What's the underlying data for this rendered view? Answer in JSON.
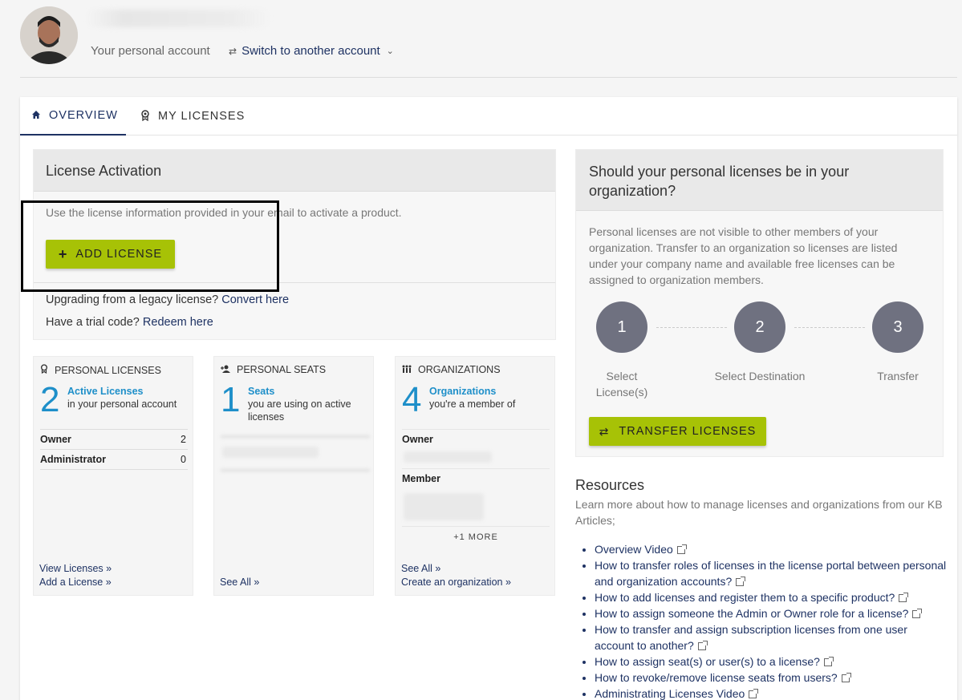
{
  "account": {
    "label": "Your personal account",
    "switch_label": "Switch to another account"
  },
  "tabs": [
    {
      "label": "OVERVIEW",
      "icon": "home-icon"
    },
    {
      "label": "MY LICENSES",
      "icon": "badge-icon"
    }
  ],
  "activation": {
    "title": "License Activation",
    "description": "Use the license information provided in your email to activate a product.",
    "add_button": "ADD LICENSE",
    "legacy_text": "Upgrading from a legacy license?",
    "legacy_link": "Convert here",
    "trial_text": "Have a trial code?",
    "trial_link": "Redeem here"
  },
  "stats": {
    "licenses": {
      "title": "PERSONAL LICENSES",
      "count": "2",
      "headline": "Active Licenses",
      "sub": "in your personal account",
      "rows": [
        {
          "label": "Owner",
          "value": "2"
        },
        {
          "label": "Administrator",
          "value": "0"
        }
      ],
      "links": [
        "View Licenses »",
        "Add a License »"
      ]
    },
    "seats": {
      "title": "PERSONAL SEATS",
      "count": "1",
      "headline": "Seats",
      "sub": "you are using on active licenses",
      "link": "See All »"
    },
    "orgs": {
      "title": "ORGANIZATIONS",
      "count": "4",
      "headline": "Organizations",
      "sub": "you're a member of",
      "owner_label": "Owner",
      "member_label": "Member",
      "more": "+1 MORE",
      "links": [
        "See All »",
        "Create an organization »"
      ]
    }
  },
  "org_transfer": {
    "title": "Should your personal licenses be in your organization?",
    "description": "Personal licenses are not visible to other members of your organization. Transfer to an organization so licenses are listed under your company name and available free licenses can be assigned to organization members.",
    "steps": [
      {
        "num": "1",
        "label": "Select License(s)"
      },
      {
        "num": "2",
        "label": "Select Destination"
      },
      {
        "num": "3",
        "label": "Transfer"
      }
    ],
    "button": "TRANSFER LICENSES"
  },
  "resources": {
    "title": "Resources",
    "description": "Learn more about how to manage licenses and organizations from our KB Articles;",
    "items": [
      "Overview Video",
      "How to transfer roles of licenses in the license portal between personal and organization accounts?",
      "How to add licenses and register them to a specific product?",
      "How to assign someone the Admin or Owner role for a license?",
      "How to transfer and assign subscription licenses from one user account to another?",
      "How to assign seat(s) or user(s) to a license?",
      "How to revoke/remove license seats from users?",
      "Administrating Licenses Video"
    ]
  },
  "colors": {
    "primary": "#1e3263",
    "accent_button": "#a7c206",
    "count_blue": "#1e8fc9",
    "step_gray": "#6f7180"
  }
}
